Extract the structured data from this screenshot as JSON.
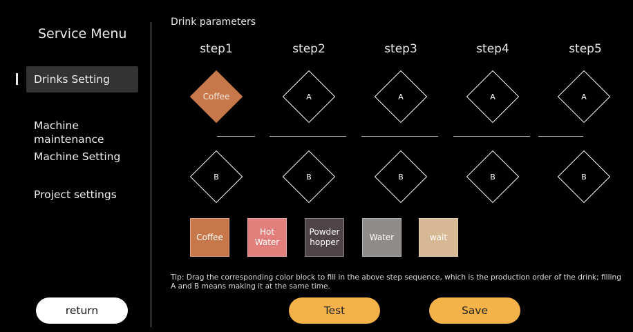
{
  "sidebar": {
    "title": "Service Menu",
    "items": [
      {
        "label": "Drinks Setting"
      },
      {
        "label": "Machine\nmaintenance"
      },
      {
        "label": "Machine Setting"
      },
      {
        "label": "Project settings"
      }
    ],
    "return_label": "return"
  },
  "main": {
    "title": "Drink parameters",
    "steps": [
      {
        "label": "step1",
        "slot_a": "Coffee",
        "slot_b": "B"
      },
      {
        "label": "step2",
        "slot_a": "A",
        "slot_b": "B"
      },
      {
        "label": "step3",
        "slot_a": "A",
        "slot_b": "B"
      },
      {
        "label": "step4",
        "slot_a": "A",
        "slot_b": "B"
      },
      {
        "label": "step5",
        "slot_a": "A",
        "slot_b": "B"
      }
    ],
    "blocks": [
      {
        "label": "Coffee",
        "color": "#c8774a"
      },
      {
        "label": "Hot Water",
        "color": "#e07f7b"
      },
      {
        "label": "Powder hopper",
        "color": "#4f4548"
      },
      {
        "label": "Water",
        "color": "#8f8c8a"
      },
      {
        "label": "wait",
        "color": "#d7b894"
      }
    ],
    "tip": "Tip: Drag the corresponding color block to fill in the above step sequence, which is the production order of the drink; filling A and B means making it at the same time.",
    "test_label": "Test",
    "save_label": "Save"
  },
  "colors": {
    "accent": "#f4b249",
    "filled_slot": "#c8774a"
  }
}
